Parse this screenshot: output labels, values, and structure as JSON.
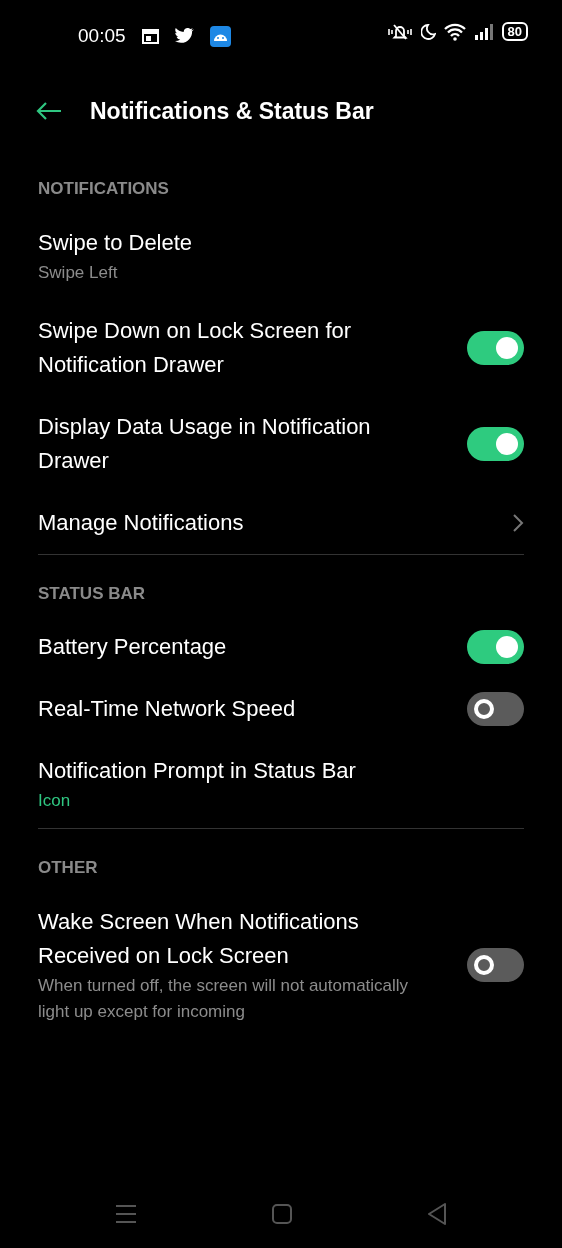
{
  "status_bar": {
    "time": "00:05",
    "battery": "80"
  },
  "header": {
    "title": "Notifications & Status Bar"
  },
  "sections": [
    {
      "title": "NOTIFICATIONS",
      "items": [
        {
          "kind": "value",
          "title": "Swipe to Delete",
          "value": "Swipe Left",
          "accent": false
        },
        {
          "kind": "toggle",
          "title": "Swipe Down on Lock Screen for Notification Drawer",
          "on": true
        },
        {
          "kind": "toggle",
          "title": "Display Data Usage in Notification Drawer",
          "on": true
        },
        {
          "kind": "link",
          "title": "Manage Notifications"
        }
      ]
    },
    {
      "title": "STATUS BAR",
      "items": [
        {
          "kind": "toggle",
          "title": "Battery Percentage",
          "on": true
        },
        {
          "kind": "toggle",
          "title": "Real-Time Network Speed",
          "on": false
        },
        {
          "kind": "value",
          "title": "Notification Prompt in Status Bar",
          "value": "Icon",
          "accent": true
        }
      ]
    },
    {
      "title": "OTHER",
      "items": [
        {
          "kind": "toggle",
          "title": "Wake Screen When Notifications Received on Lock Screen",
          "description": "When turned off, the screen will not automatically light up except for incoming",
          "on": false
        }
      ]
    }
  ]
}
